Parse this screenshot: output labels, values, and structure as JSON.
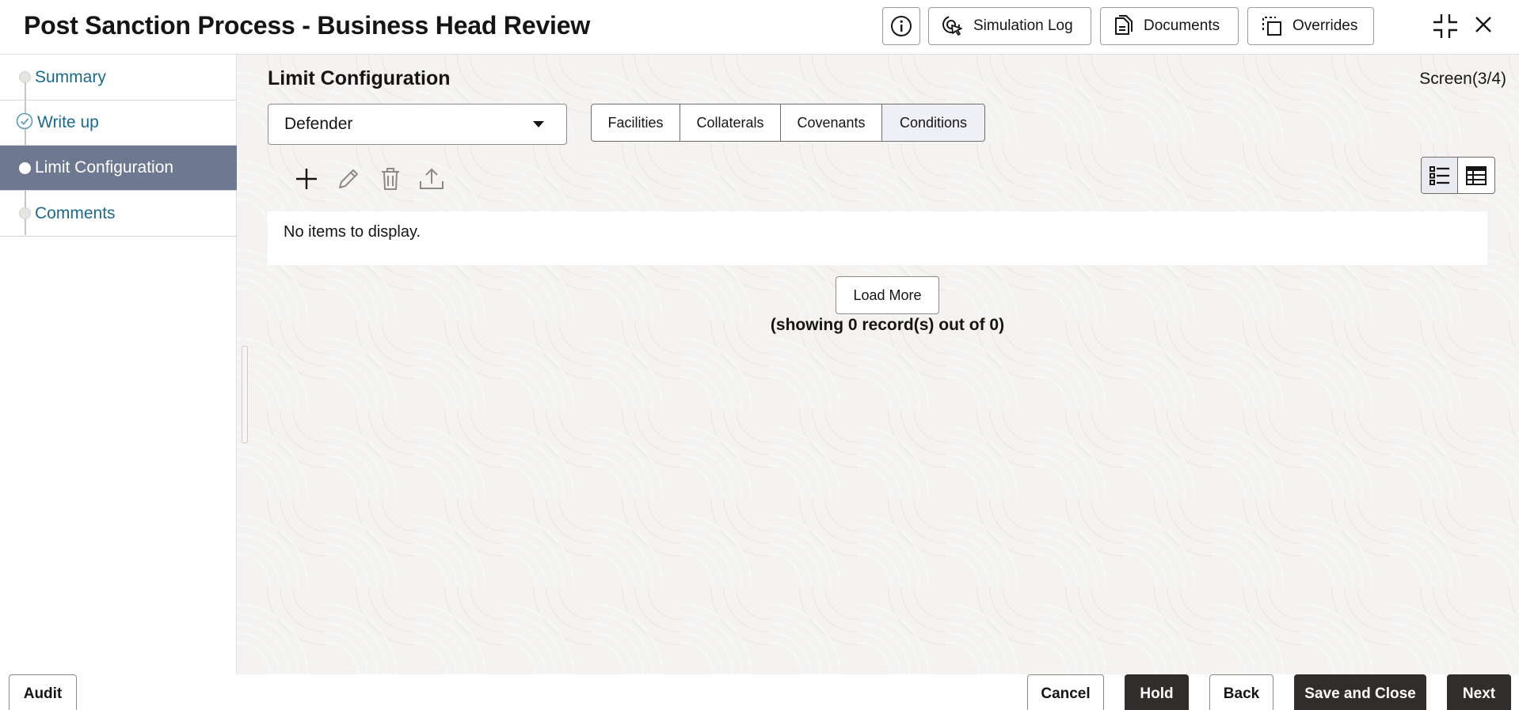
{
  "header": {
    "title": "Post Sanction Process - Business Head Review",
    "buttons": {
      "simulation_log": "Simulation Log",
      "documents": "Documents",
      "overrides": "Overrides"
    },
    "icons": [
      "info-icon",
      "simulation-icon",
      "documents-icon",
      "overrides-icon",
      "collapse-icon",
      "close-icon"
    ]
  },
  "sidebar": {
    "steps": [
      {
        "label": "Summary",
        "state": "visited"
      },
      {
        "label": "Write up",
        "state": "completed"
      },
      {
        "label": "Limit Configuration",
        "state": "active"
      },
      {
        "label": "Comments",
        "state": "pending"
      }
    ],
    "active_color": "#6e7891",
    "link_color": "#1a6a8e"
  },
  "main": {
    "section_title": "Limit Configuration",
    "screen_counter": "Screen(3/4)",
    "party_select": {
      "value": "Defender"
    },
    "tabs": [
      {
        "label": "Facilities"
      },
      {
        "label": "Collaterals"
      },
      {
        "label": "Covenants"
      },
      {
        "label": "Conditions",
        "selected": true
      }
    ],
    "toolbar": [
      "add-icon",
      "edit-icon",
      "delete-icon",
      "upload-icon"
    ],
    "view_toggle": [
      "list-view-icon",
      "table-view-icon"
    ],
    "empty_message": "No items to display.",
    "load_more": "Load More",
    "record_count": "(showing 0 record(s) out of 0)"
  },
  "footer": {
    "audit": "Audit",
    "cancel": "Cancel",
    "hold": "Hold",
    "back": "Back",
    "save_and_close": "Save and Close",
    "next": "Next",
    "dark_button_color": "#312d2a"
  }
}
